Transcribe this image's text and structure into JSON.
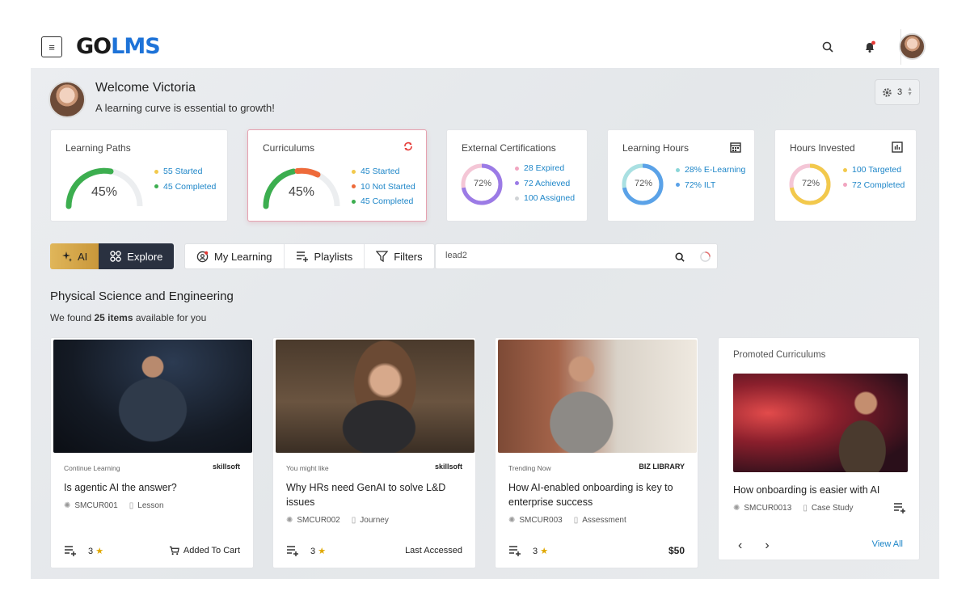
{
  "app": {
    "logo_go": "GO",
    "logo_lms": "LMS"
  },
  "header": {
    "menu_icon": "hamburger-icon",
    "search_icon": "search-icon",
    "notification_icon": "bell-icon"
  },
  "welcome": {
    "title": "Welcome Victoria",
    "subtitle": "A learning curve is essential to growth!",
    "settings_count": "3"
  },
  "stats": {
    "learning_paths": {
      "title": "Learning Paths",
      "percent": "45%",
      "items": [
        "55 Started",
        "45 Completed"
      ]
    },
    "curriculums": {
      "title": "Curriculums",
      "percent": "45%",
      "items": [
        "45 Started",
        "10 Not Started",
        "45 Completed"
      ]
    },
    "external_certifications": {
      "title": "External Certifications",
      "percent": "72%",
      "items": [
        "28 Expired",
        "72 Achieved",
        "100 Assigned"
      ]
    },
    "learning_hours": {
      "title": "Learning Hours",
      "percent": "72%",
      "items": [
        "28% E-Learning",
        "72% ILT"
      ]
    },
    "hours_invested": {
      "title": "Hours Invested",
      "percent": "72%",
      "items": [
        "100 Targeted",
        "72 Completed"
      ]
    }
  },
  "colors": {
    "green": "#3cae4f",
    "orange": "#ee6a3a",
    "purple": "#9b7be6",
    "blue": "#5ba2e8",
    "yellow": "#f2c94c",
    "pink": "#f1a5c0",
    "teal": "#8ad6d8",
    "accent_blue": "#1e73d8"
  },
  "toolbar": {
    "ai": "AI",
    "explore": "Explore",
    "my_learning": "My Learning",
    "playlists": "Playlists",
    "filters": "Filters"
  },
  "search": {
    "value": "lead2"
  },
  "section": {
    "title": "Physical Science and Engineering",
    "found_prefix": "We found",
    "found_count": "25 items",
    "found_suffix": "available for you"
  },
  "courses": [
    {
      "tag": "Continue Learning",
      "vendor": "skillsoft",
      "title": "Is agentic AI the answer?",
      "code": "SMCUR001",
      "type": "Lesson",
      "rating": "3",
      "action": "Added To Cart"
    },
    {
      "tag": "You might like",
      "vendor": "skillsoft",
      "title": "Why HRs need GenAI to solve L&D issues",
      "code": "SMCUR002",
      "type": "Journey",
      "rating": "3",
      "action": "Last Accessed"
    },
    {
      "tag": "Trending Now",
      "vendor": "BIZ LIBRARY",
      "title": "How AI-enabled onboarding is key to enterprise success",
      "code": "SMCUR003",
      "type": "Assessment",
      "rating": "3",
      "action": "$50"
    }
  ],
  "promo": {
    "title": "Promoted Curriculums",
    "name": "How onboarding is easier with AI",
    "code": "SMCUR0013",
    "type": "Case Study",
    "view_all": "View All"
  }
}
